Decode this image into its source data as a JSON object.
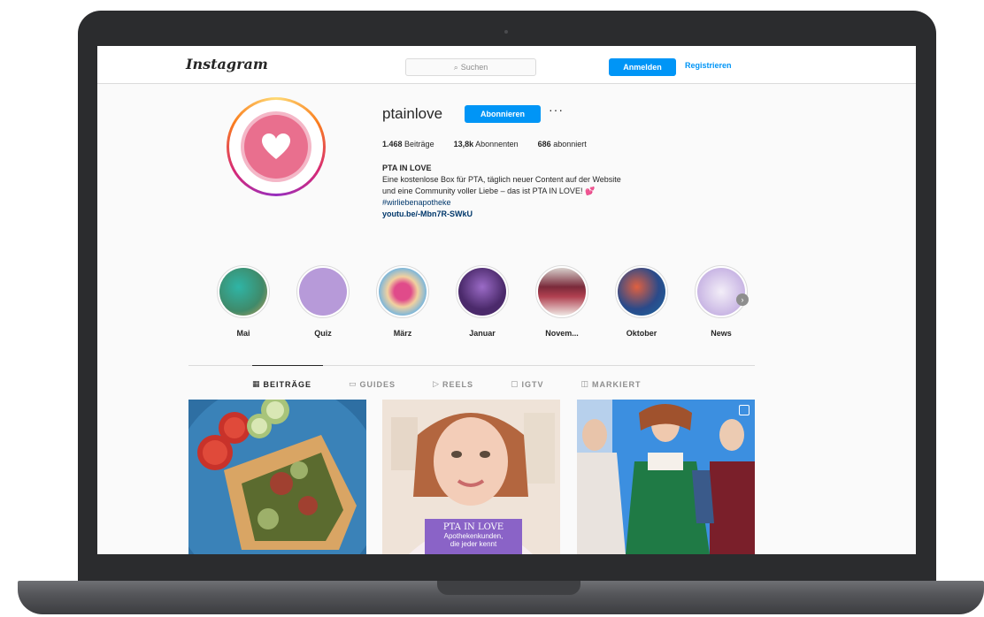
{
  "header": {
    "logo": "Instagram",
    "search_placeholder": "Suchen",
    "login_label": "Anmelden",
    "register_label": "Registrieren"
  },
  "profile": {
    "username": "ptainlove",
    "follow_label": "Abonnieren",
    "more_label": "···",
    "stats": {
      "posts_count": "1.468",
      "posts_label": "Beiträge",
      "followers_count": "13,8k",
      "followers_label": "Abonnenten",
      "following_count": "686",
      "following_label": "abonniert"
    },
    "bio": {
      "name": "PTA IN LOVE",
      "line1": "Eine kostenlose Box für PTA, täglich neuer Content auf der Website",
      "line2": "und eine Community voller Liebe – das ist PTA IN LOVE!",
      "heart": "💕",
      "hashtag": "#wirliebenapotheke",
      "url": "youtu.be/-Mbn7R-SWkU"
    }
  },
  "highlights": [
    {
      "label": "Mai",
      "color": "#3f8a6a"
    },
    {
      "label": "Quiz",
      "color": "#b79ad9"
    },
    {
      "label": "März",
      "color": "#d98aa8"
    },
    {
      "label": "Januar",
      "color": "#4b2a6b"
    },
    {
      "label": "Novem...",
      "color": "#7a2a3a"
    },
    {
      "label": "Oktober",
      "color": "#2a4a8a"
    },
    {
      "label": "News",
      "color": "#c9b6e4"
    }
  ],
  "tabs": [
    {
      "label": "BEITRÄGE",
      "icon": "grid-icon",
      "active": true
    },
    {
      "label": "GUIDES",
      "icon": "guide-icon",
      "active": false
    },
    {
      "label": "REELS",
      "icon": "reels-icon",
      "active": false
    },
    {
      "label": "IGTV",
      "icon": "igtv-icon",
      "active": false
    },
    {
      "label": "MARKIERT",
      "icon": "tag-icon",
      "active": false
    }
  ],
  "posts": {
    "post2_overlay_title": "PTA IN LOVE",
    "post2_overlay_line1": "Apothekenkunden,",
    "post2_overlay_line2": "die jeder kennt"
  },
  "colors": {
    "accent": "#0095f6",
    "brand_pink": "#e96f8e"
  }
}
